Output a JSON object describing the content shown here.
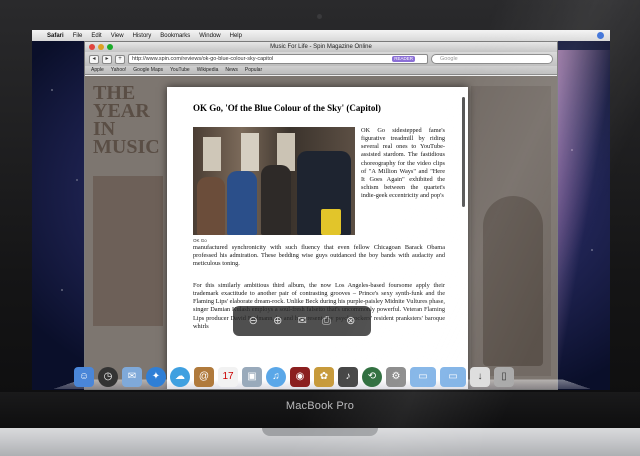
{
  "menubar": {
    "apple": "",
    "app": "Safari",
    "items": [
      "File",
      "Edit",
      "View",
      "History",
      "Bookmarks",
      "Window",
      "Help"
    ]
  },
  "window": {
    "title": "Music For Life - Spin Magazine Online",
    "url": "http://www.spin.com/reviews/ok-go-blue-colour-sky-capitol",
    "reader_badge": "READER",
    "search_placeholder": "Google",
    "bookmarks": [
      "Apple",
      "Yahoo!",
      "Google Maps",
      "YouTube",
      "Wikipedia",
      "News",
      "Popular"
    ]
  },
  "background_page": {
    "heading": "THE YEAR IN MUSIC"
  },
  "article": {
    "title": "OK Go, 'Of the Blue Colour of the Sky' (Capitol)",
    "caption": "OK Go",
    "para1_side": "OK Go sidestepped fame's figurative treadmill by riding several real ones to YouTube-assisted stardom. The fastidious choreography for the video clips of \"A Million Ways\" and \"Here It Goes Again\" exhibited the schism between the quartet's indie-geek eccentricity and pop's",
    "para1_rest": "manufactured synchronicity with such fluency that even fellow Chicagoan Barack Obama professed his admiration. These bedding wise guys outdanced the boy bands with audacity and meticulous toning.",
    "para2": "For this similarly ambitious third album, the now Los Angeles-based foursome apply their trademark exactitude to another pair of contrasting grooves – Prince's sexy synth-funk and the Flaming Lips' elaborate dream-rock. Unlike Beck during his purple-paisley Midnite Vultures phase, singer Damian Kulash employs a soul-fresh falsetto that's uncommonly powerful. Veteran Flaming Lips producer David Fridmann, he and his present-day psych rockers' resident pranksters' baroque whirls"
  },
  "reader_toolbar": {
    "icons": [
      "zoom-out-icon",
      "zoom-in-icon",
      "mail-icon",
      "print-icon",
      "close-icon"
    ]
  },
  "dock": {
    "icons": [
      "finder-icon",
      "dashboard-icon",
      "mail-icon",
      "safari-icon",
      "ichat-icon",
      "address-book-icon",
      "ical-icon",
      "preview-icon",
      "itunes-icon",
      "photo-booth-icon",
      "iphoto-icon",
      "garageband-icon",
      "time-machine-icon",
      "system-preferences-icon",
      "applications-folder-icon",
      "documents-folder-icon",
      "downloads-stack-icon",
      "trash-icon"
    ]
  },
  "laptop": {
    "model_label": "MacBook Pro"
  }
}
